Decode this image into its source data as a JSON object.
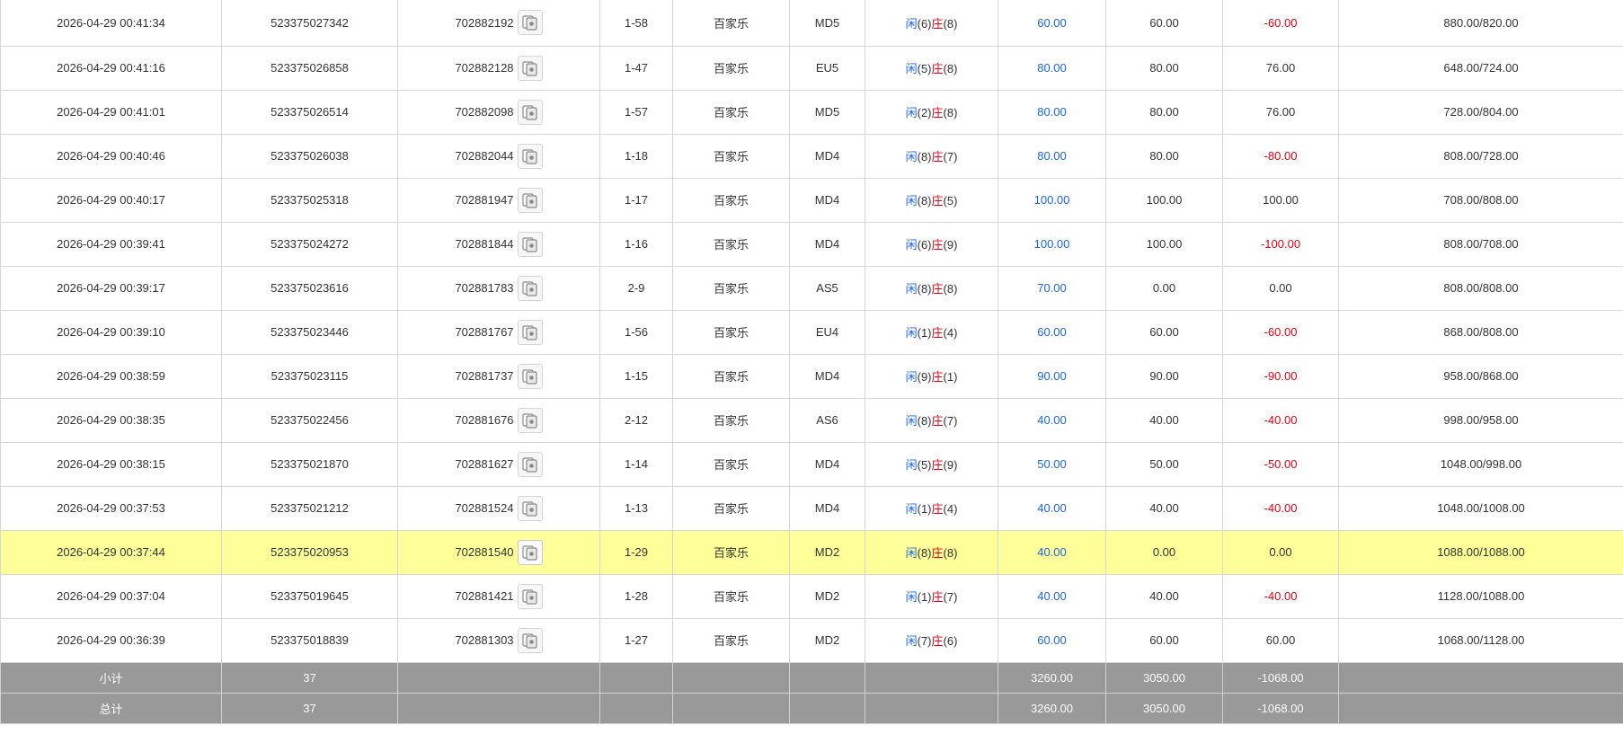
{
  "colors": {
    "blue": "#1a66e6",
    "red": "#e60012",
    "highlight": "#ffff99",
    "total_bg": "#999999"
  },
  "icon": "cards-result-icon",
  "rows": [
    {
      "time": "2026-04-29 00:41:34",
      "order": "523375027342",
      "round": "702882192",
      "table": "1-58",
      "game": "百家乐",
      "type": "MD5",
      "p_label": "闲",
      "p": "(6)",
      "b_label": "庄",
      "b": "(8)",
      "bet": "60.00",
      "valid": "60.00",
      "win": "-60.00",
      "balance": "880.00/820.00"
    },
    {
      "time": "2026-04-29 00:41:16",
      "order": "523375026858",
      "round": "702882128",
      "table": "1-47",
      "game": "百家乐",
      "type": "EU5",
      "p_label": "闲",
      "p": "(5)",
      "b_label": "庄",
      "b": "(8)",
      "bet": "80.00",
      "valid": "80.00",
      "win": "76.00",
      "balance": "648.00/724.00"
    },
    {
      "time": "2026-04-29 00:41:01",
      "order": "523375026514",
      "round": "702882098",
      "table": "1-57",
      "game": "百家乐",
      "type": "MD5",
      "p_label": "闲",
      "p": "(2)",
      "b_label": "庄",
      "b": "(8)",
      "bet": "80.00",
      "valid": "80.00",
      "win": "76.00",
      "balance": "728.00/804.00"
    },
    {
      "time": "2026-04-29 00:40:46",
      "order": "523375026038",
      "round": "702882044",
      "table": "1-18",
      "game": "百家乐",
      "type": "MD4",
      "p_label": "闲",
      "p": "(8)",
      "b_label": "庄",
      "b": "(7)",
      "bet": "80.00",
      "valid": "80.00",
      "win": "-80.00",
      "balance": "808.00/728.00"
    },
    {
      "time": "2026-04-29 00:40:17",
      "order": "523375025318",
      "round": "702881947",
      "table": "1-17",
      "game": "百家乐",
      "type": "MD4",
      "p_label": "闲",
      "p": "(8)",
      "b_label": "庄",
      "b": "(5)",
      "bet": "100.00",
      "valid": "100.00",
      "win": "100.00",
      "balance": "708.00/808.00"
    },
    {
      "time": "2026-04-29 00:39:41",
      "order": "523375024272",
      "round": "702881844",
      "table": "1-16",
      "game": "百家乐",
      "type": "MD4",
      "p_label": "闲",
      "p": "(6)",
      "b_label": "庄",
      "b": "(9)",
      "bet": "100.00",
      "valid": "100.00",
      "win": "-100.00",
      "balance": "808.00/708.00"
    },
    {
      "time": "2026-04-29 00:39:17",
      "order": "523375023616",
      "round": "702881783",
      "table": "2-9",
      "game": "百家乐",
      "type": "AS5",
      "p_label": "闲",
      "p": "(8)",
      "b_label": "庄",
      "b": "(8)",
      "bet": "70.00",
      "valid": "0.00",
      "win": "0.00",
      "balance": "808.00/808.00"
    },
    {
      "time": "2026-04-29 00:39:10",
      "order": "523375023446",
      "round": "702881767",
      "table": "1-56",
      "game": "百家乐",
      "type": "EU4",
      "p_label": "闲",
      "p": "(1)",
      "b_label": "庄",
      "b": "(4)",
      "bet": "60.00",
      "valid": "60.00",
      "win": "-60.00",
      "balance": "868.00/808.00"
    },
    {
      "time": "2026-04-29 00:38:59",
      "order": "523375023115",
      "round": "702881737",
      "table": "1-15",
      "game": "百家乐",
      "type": "MD4",
      "p_label": "闲",
      "p": "(9)",
      "b_label": "庄",
      "b": "(1)",
      "bet": "90.00",
      "valid": "90.00",
      "win": "-90.00",
      "balance": "958.00/868.00"
    },
    {
      "time": "2026-04-29 00:38:35",
      "order": "523375022456",
      "round": "702881676",
      "table": "2-12",
      "game": "百家乐",
      "type": "AS6",
      "p_label": "闲",
      "p": "(8)",
      "b_label": "庄",
      "b": "(7)",
      "bet": "40.00",
      "valid": "40.00",
      "win": "-40.00",
      "balance": "998.00/958.00"
    },
    {
      "time": "2026-04-29 00:38:15",
      "order": "523375021870",
      "round": "702881627",
      "table": "1-14",
      "game": "百家乐",
      "type": "MD4",
      "p_label": "闲",
      "p": "(5)",
      "b_label": "庄",
      "b": "(9)",
      "bet": "50.00",
      "valid": "50.00",
      "win": "-50.00",
      "balance": "1048.00/998.00"
    },
    {
      "time": "2026-04-29 00:37:53",
      "order": "523375021212",
      "round": "702881524",
      "table": "1-13",
      "game": "百家乐",
      "type": "MD4",
      "p_label": "闲",
      "p": "(1)",
      "b_label": "庄",
      "b": "(4)",
      "bet": "40.00",
      "valid": "40.00",
      "win": "-40.00",
      "balance": "1048.00/1008.00"
    },
    {
      "time": "2026-04-29 00:37:44",
      "order": "523375020953",
      "round": "702881540",
      "table": "1-29",
      "game": "百家乐",
      "type": "MD2",
      "p_label": "闲",
      "p": "(8)",
      "b_label": "庄",
      "b": "(8)",
      "bet": "40.00",
      "valid": "0.00",
      "win": "0.00",
      "balance": "1088.00/1088.00",
      "highlight": true
    },
    {
      "time": "2026-04-29 00:37:04",
      "order": "523375019645",
      "round": "702881421",
      "table": "1-28",
      "game": "百家乐",
      "type": "MD2",
      "p_label": "闲",
      "p": "(1)",
      "b_label": "庄",
      "b": "(7)",
      "bet": "40.00",
      "valid": "40.00",
      "win": "-40.00",
      "balance": "1128.00/1088.00"
    },
    {
      "time": "2026-04-29 00:36:39",
      "order": "523375018839",
      "round": "702881303",
      "table": "1-27",
      "game": "百家乐",
      "type": "MD2",
      "p_label": "闲",
      "p": "(7)",
      "b_label": "庄",
      "b": "(6)",
      "bet": "60.00",
      "valid": "60.00",
      "win": "60.00",
      "balance": "1068.00/1128.00"
    }
  ],
  "subtotal": {
    "label": "小计",
    "count": "37",
    "bet": "3260.00",
    "valid": "3050.00",
    "win": "-1068.00"
  },
  "total": {
    "label": "总计",
    "count": "37",
    "bet": "3260.00",
    "valid": "3050.00",
    "win": "-1068.00"
  }
}
